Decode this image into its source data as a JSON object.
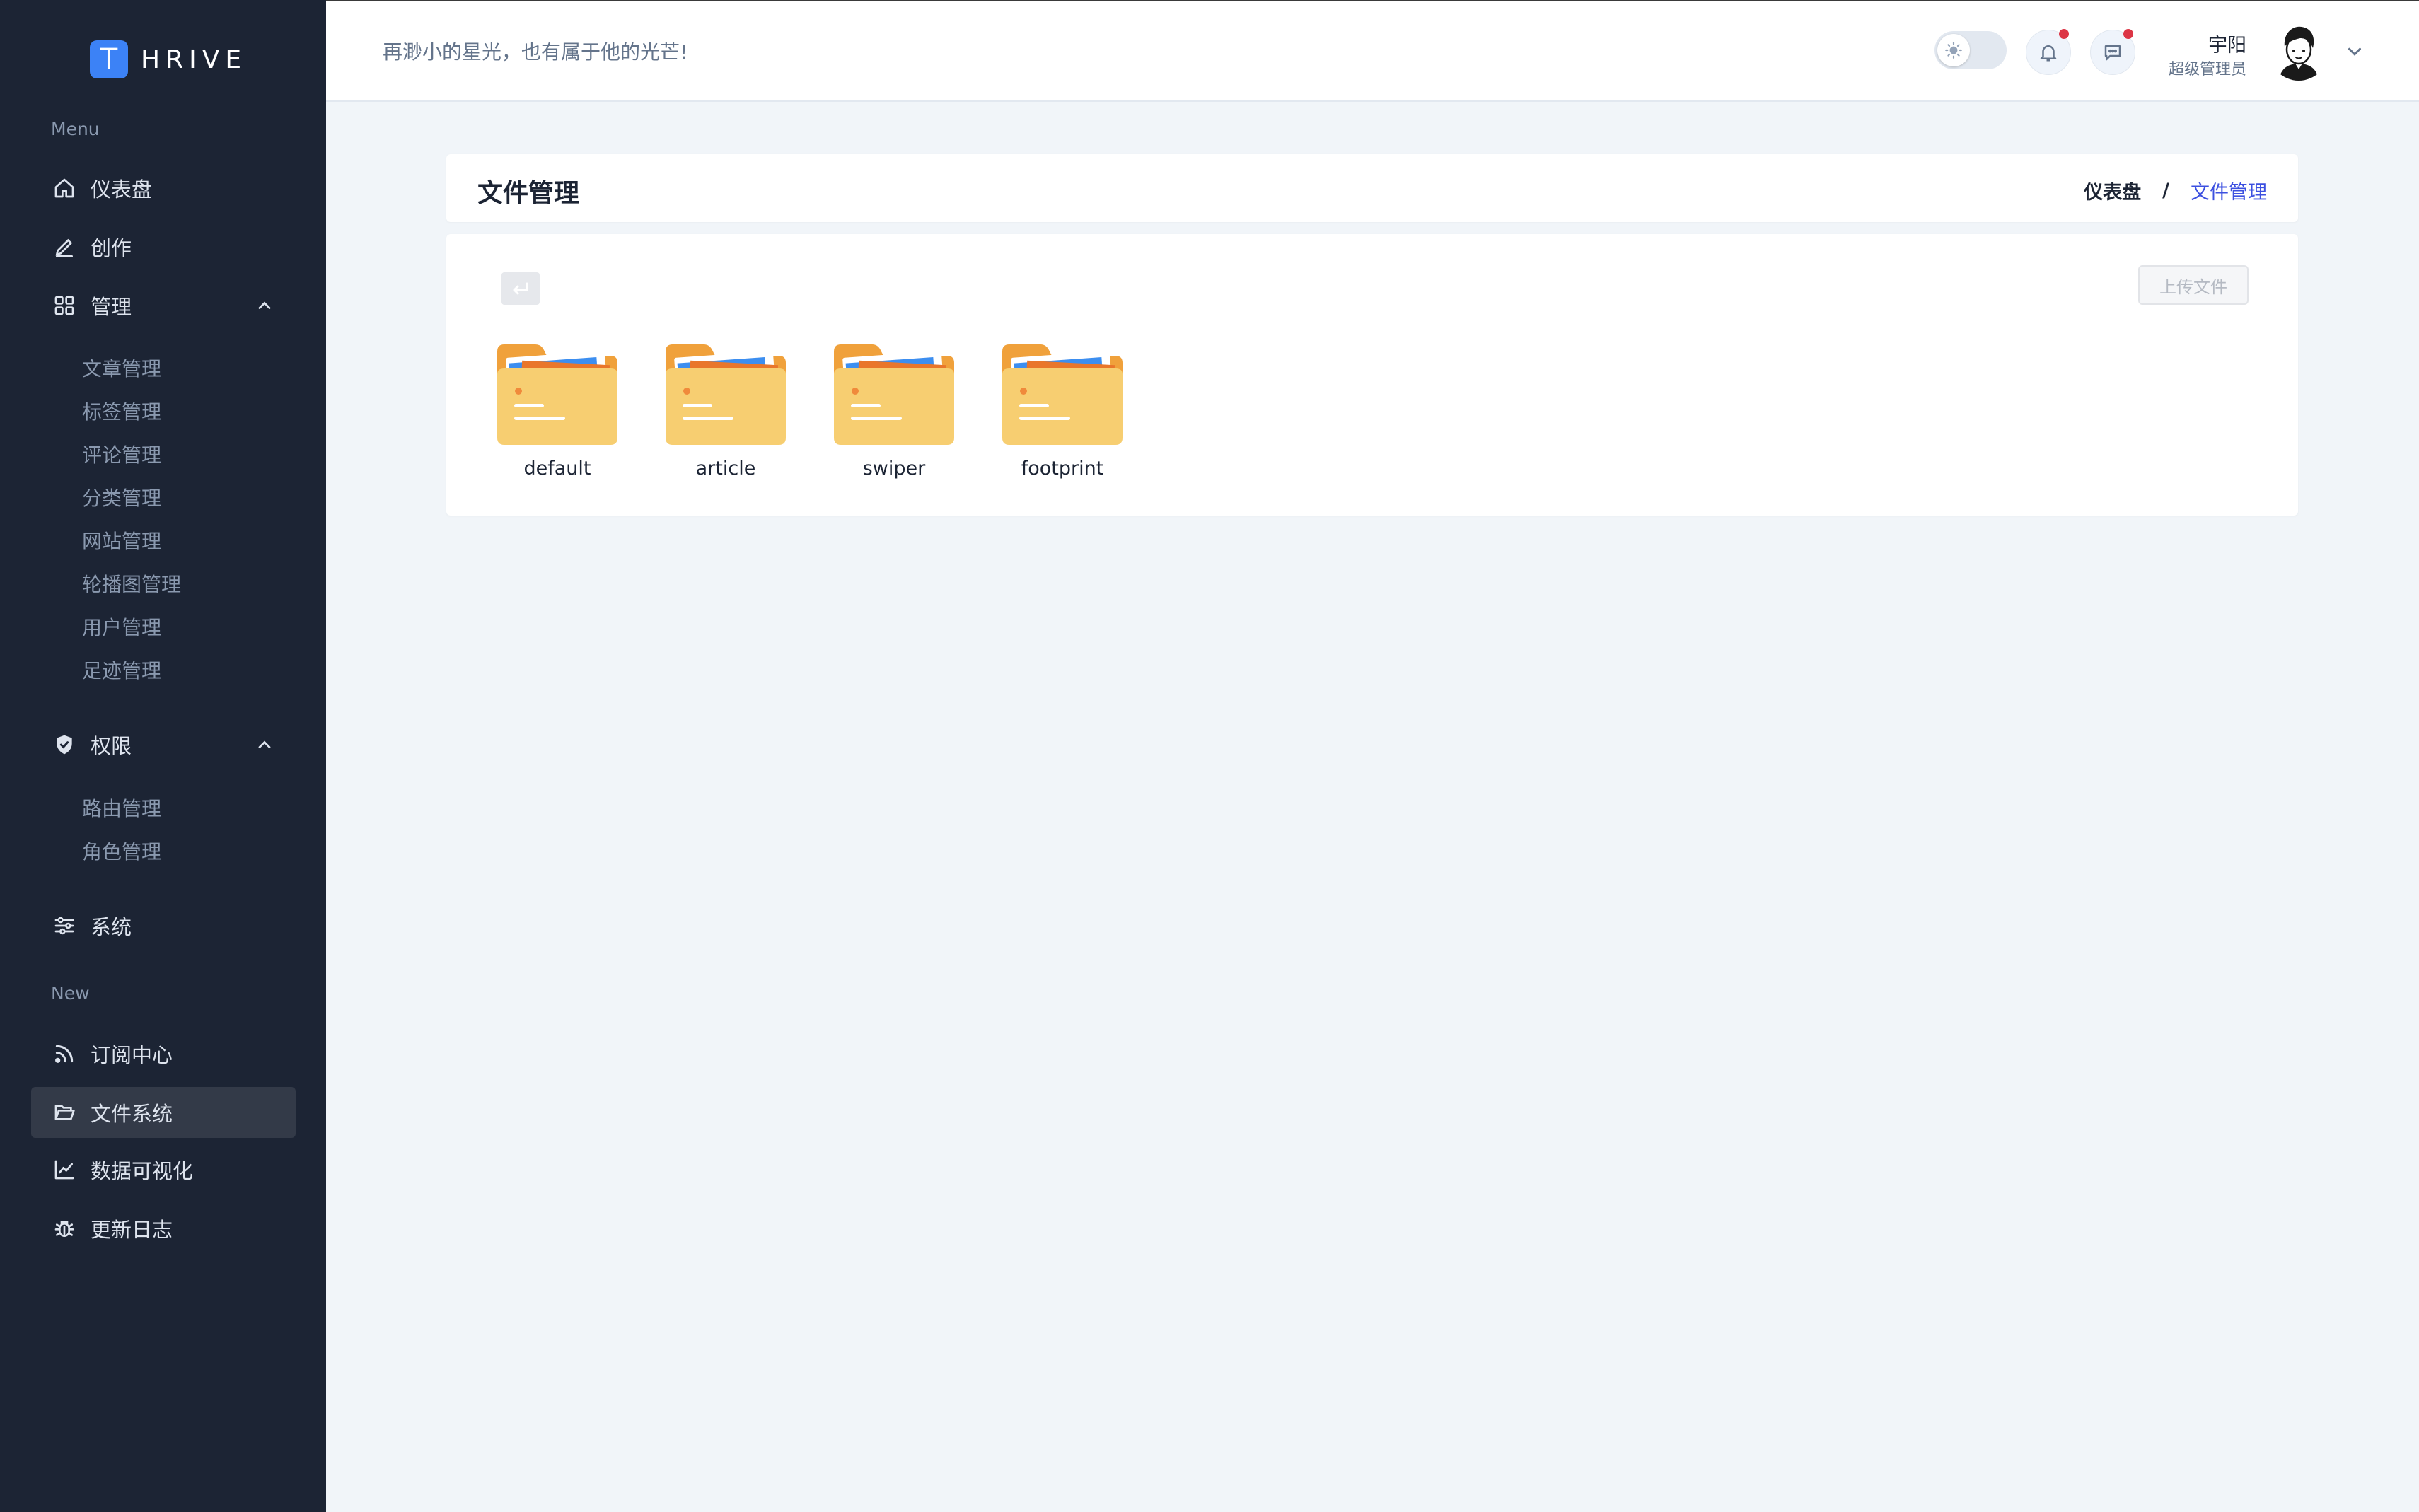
{
  "brand": {
    "badge": "T",
    "name": "HRIVE"
  },
  "sidebar": {
    "section_menu": "Menu",
    "section_new": "New",
    "items": {
      "dashboard": "仪表盘",
      "create": "创作",
      "manage": "管理",
      "permission": "权限",
      "system": "系统",
      "subscribe": "订阅中心",
      "filesystem": "文件系统",
      "dataviz": "数据可视化",
      "changelog": "更新日志"
    },
    "manage_sub": [
      "文章管理",
      "标签管理",
      "评论管理",
      "分类管理",
      "网站管理",
      "轮播图管理",
      "用户管理",
      "足迹管理"
    ],
    "permission_sub": [
      "路由管理",
      "角色管理"
    ],
    "active_item": "filesystem"
  },
  "header": {
    "slogan": "再渺小的星光，也有属于他的光芒!",
    "user_name": "宇阳",
    "user_role": "超级管理员"
  },
  "page": {
    "title": "文件管理",
    "breadcrumb_home": "仪表盘",
    "breadcrumb_sep": "/",
    "breadcrumb_current": "文件管理",
    "upload_label": "上传文件"
  },
  "folders": [
    "default",
    "article",
    "swiper",
    "footprint"
  ],
  "colors": {
    "sidebar_bg": "#1c2434",
    "accent": "#3c50e0",
    "notification_dot": "#dc3545",
    "folder_back": "#f0a13b",
    "folder_front": "#f7ce71"
  }
}
